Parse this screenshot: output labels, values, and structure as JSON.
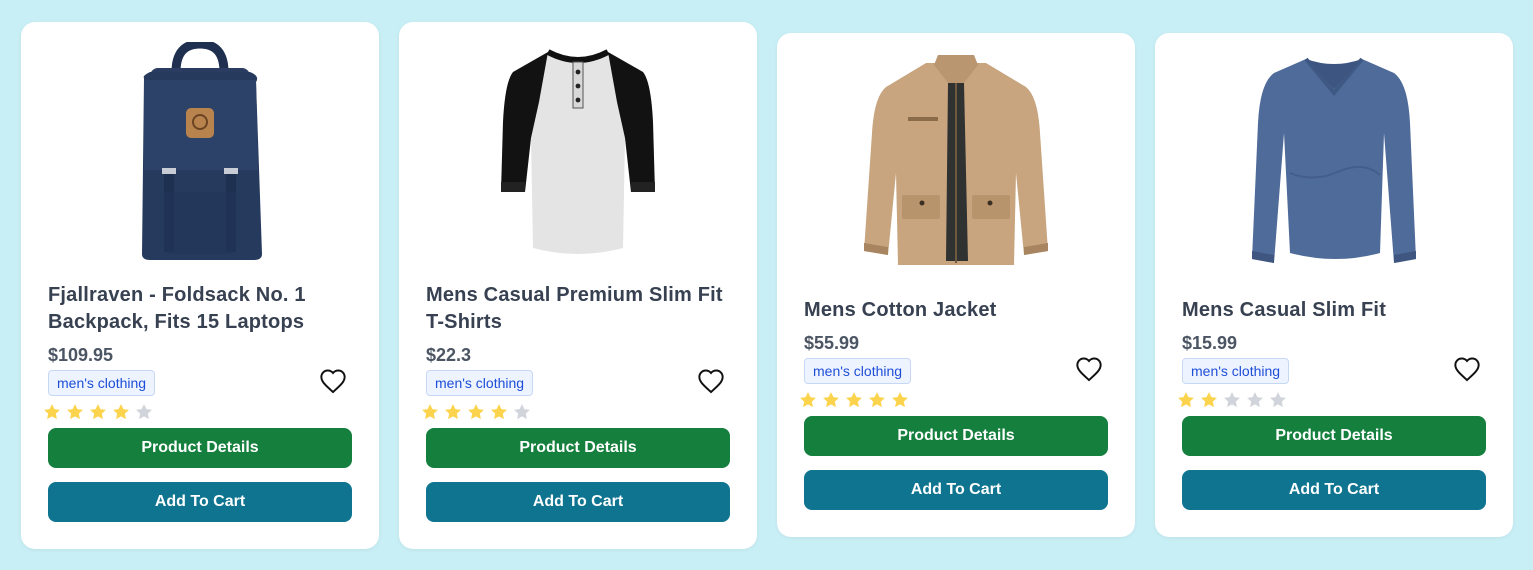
{
  "products": [
    {
      "title": "Fjallraven - Foldsack No. 1 Backpack, Fits 15 Laptops",
      "price": "$109.95",
      "category": "men's clothing",
      "rating_stars": 4,
      "rating_max": 5,
      "image_icon": "backpack-image",
      "details_label": "Product Details",
      "cart_label": "Add To Cart"
    },
    {
      "title": "Mens Casual Premium Slim Fit T-Shirts",
      "price": "$22.3",
      "category": "men's clothing",
      "rating_stars": 4,
      "rating_max": 5,
      "image_icon": "raglan-tshirt-image",
      "details_label": "Product Details",
      "cart_label": "Add To Cart"
    },
    {
      "title": "Mens Cotton Jacket",
      "price": "$55.99",
      "category": "men's clothing",
      "rating_stars": 5,
      "rating_max": 5,
      "image_icon": "jacket-image",
      "details_label": "Product Details",
      "cart_label": "Add To Cart"
    },
    {
      "title": "Mens Casual Slim Fit",
      "price": "$15.99",
      "category": "men's clothing",
      "rating_stars": 2,
      "rating_max": 5,
      "image_icon": "long-sleeve-shirt-image",
      "details_label": "Product Details",
      "cart_label": "Add To Cart"
    }
  ],
  "colors": {
    "background": "#c9eff6",
    "details_button": "#15803d",
    "cart_button": "#0e7490",
    "star_filled": "#fcd34d",
    "star_empty": "#d1d5db",
    "badge_text": "#1d4ed8"
  }
}
